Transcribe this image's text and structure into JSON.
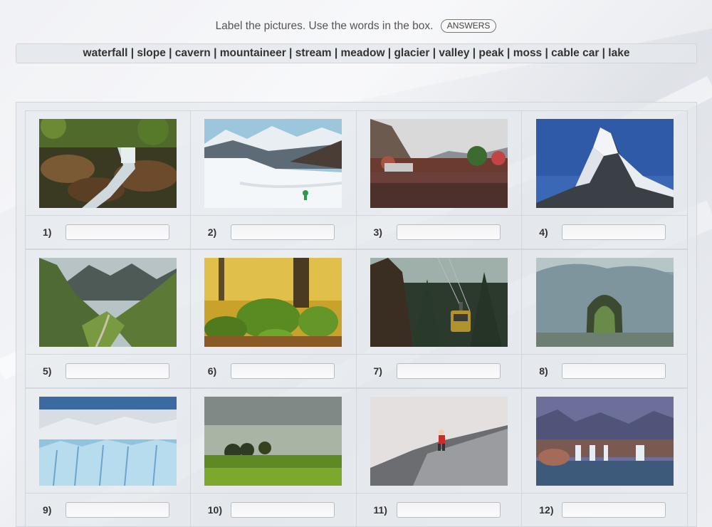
{
  "instructions": "Label the pictures. Use the words in the box.",
  "answers_button": "ANSWERS",
  "word_box": "waterfall | slope | cavern | mountaineer | stream | meadow | glacier | valley | peak | moss | cable car | lake",
  "items": [
    {
      "number": "1)",
      "value": "",
      "picture": "stream-photo"
    },
    {
      "number": "2)",
      "value": "",
      "picture": "ski-slope-photo"
    },
    {
      "number": "3)",
      "value": "",
      "picture": "lake-photo"
    },
    {
      "number": "4)",
      "value": "",
      "picture": "mountain-peak-photo"
    },
    {
      "number": "5)",
      "value": "",
      "picture": "valley-photo"
    },
    {
      "number": "6)",
      "value": "",
      "picture": "moss-forest-photo"
    },
    {
      "number": "7)",
      "value": "",
      "picture": "cable-car-photo"
    },
    {
      "number": "8)",
      "value": "",
      "picture": "cavern-photo"
    },
    {
      "number": "9)",
      "value": "",
      "picture": "glacier-photo"
    },
    {
      "number": "10)",
      "value": "",
      "picture": "meadow-photo"
    },
    {
      "number": "11)",
      "value": "",
      "picture": "mountaineer-photo"
    },
    {
      "number": "12)",
      "value": "",
      "picture": "waterfall-photo"
    }
  ]
}
